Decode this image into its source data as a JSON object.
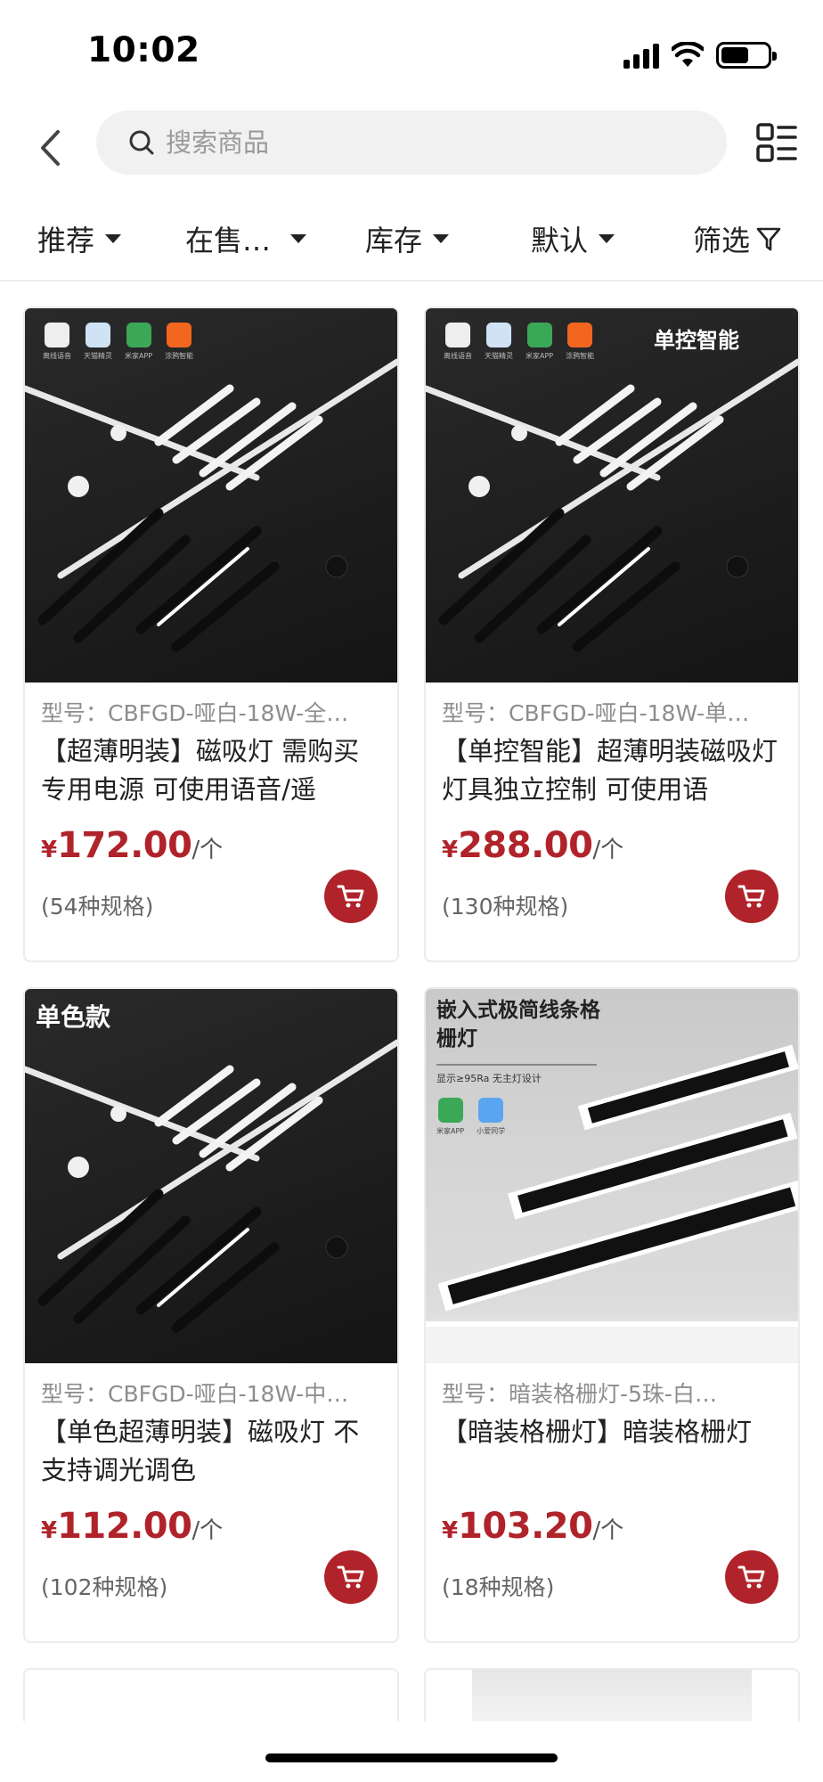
{
  "status_bar": {
    "time": "10:02"
  },
  "search": {
    "placeholder": "搜索商品"
  },
  "filters": [
    {
      "label": "推荐"
    },
    {
      "label": "在售…"
    },
    {
      "label": "库存"
    },
    {
      "label": "默认"
    },
    {
      "label": "筛选"
    }
  ],
  "products": [
    {
      "model": "型号：CBFGD-哑白-18W-全…",
      "title": "【超薄明装】磁吸灯 需购买专用电源 可使用语音/遥",
      "currency": "¥",
      "price": "172.00",
      "unit": "/个",
      "specs": "(54种规格)",
      "image_label": "",
      "image_badges": [
        "离线语音",
        "天猫精灵",
        "米家APP",
        "涂鸦智能"
      ]
    },
    {
      "model": "型号：CBFGD-哑白-18W-单…",
      "title": "【单控智能】超薄明装磁吸灯 灯具独立控制 可使用语",
      "currency": "¥",
      "price": "288.00",
      "unit": "/个",
      "specs": "(130种规格)",
      "image_label": "单控智能",
      "image_badges": [
        "离线语音",
        "天猫精灵",
        "米家APP",
        "涂鸦智能"
      ]
    },
    {
      "model": "型号：CBFGD-哑白-18W-中…",
      "title": "【单色超薄明装】磁吸灯 不支持调光调色",
      "currency": "¥",
      "price": "112.00",
      "unit": "/个",
      "specs": "(102种规格)",
      "image_label": "单色款",
      "image_badges": []
    },
    {
      "model": "型号：暗装格栅灯-5珠-白…",
      "title": "【暗装格栅灯】暗装格栅灯",
      "currency": "¥",
      "price": "103.20",
      "unit": "/个",
      "specs": "(18种规格)",
      "image_label": "嵌入式极简线条格栅灯",
      "image_sublabel": "显示≥95Ra  无主灯设计",
      "image_badges": [
        "米家APP",
        "小爱同学"
      ]
    }
  ],
  "colors": {
    "accent": "#b0232a",
    "text": "#222222",
    "muted": "#8d8d8d"
  },
  "icons": [
    "back-icon",
    "search-icon",
    "layout-toggle-icon",
    "caret-down-icon",
    "filter-funnel-icon",
    "cart-icon"
  ]
}
